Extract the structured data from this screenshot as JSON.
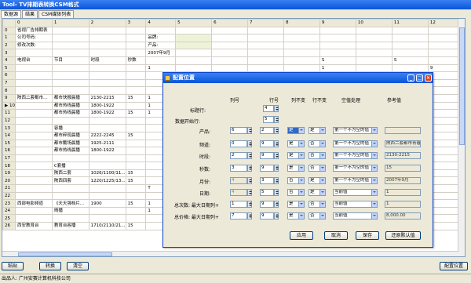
{
  "window": {
    "title": "Tool- TV排期表转换CSM格式"
  },
  "tabs": [
    "数据源",
    "结果",
    "CSM媒体列表"
  ],
  "sheet": {
    "col_headers": [
      "",
      "0",
      "1",
      "2",
      "3",
      "4",
      "5",
      "6",
      "7",
      "8",
      "9",
      "10",
      "11",
      "12"
    ],
    "rows": [
      [
        "0",
        "省视厂告排期表",
        "",
        "",
        "",
        "",
        "",
        "",
        "",
        "",
        "",
        "",
        "",
        ""
      ],
      [
        "1",
        "公司号码:",
        "",
        "",
        "",
        "品牌:",
        "",
        "",
        "",
        "",
        "",
        "",
        "",
        ""
      ],
      [
        "2",
        "修改次数:",
        "",
        "",
        "",
        "产品:",
        "",
        "",
        "",
        "",
        "",
        "",
        "",
        ""
      ],
      [
        "3",
        "",
        "",
        "",
        "",
        "2007年9月",
        "",
        "",
        "",
        "",
        "",
        "",
        "",
        ""
      ],
      [
        "4",
        "电视台",
        "节目",
        "时段",
        "秒数",
        "",
        "",
        "",
        "",
        "",
        "S",
        "",
        "S",
        ""
      ],
      [
        "5",
        "",
        "",
        "",
        "",
        "1",
        "",
        "",
        "",
        "",
        "1",
        "",
        "",
        "9"
      ],
      [
        "6",
        "",
        "",
        "",
        "",
        "",
        "",
        "",
        "",
        "",
        "",
        "",
        "",
        ""
      ],
      [
        "7",
        "",
        "",
        "",
        "",
        "",
        "",
        "",
        "",
        "",
        "",
        "",
        "",
        ""
      ],
      [
        "8",
        "",
        "",
        "",
        "",
        "",
        "",
        "",
        "",
        "",
        "",
        "",
        "",
        ""
      ],
      [
        "9",
        "陕西二套都市...",
        "都市快报晨播",
        "2130-2215",
        "15",
        "1",
        "",
        "",
        "",
        "",
        "",
        "",
        "",
        "1"
      ],
      [
        "10",
        "",
        "都市热线晨播",
        "1800-1922",
        "",
        "1",
        "",
        "",
        "",
        "",
        "",
        "",
        "",
        ""
      ],
      [
        "11",
        "",
        "都市热线晨播",
        "1800-1922",
        "15",
        "1",
        "",
        "",
        "",
        "",
        "",
        "",
        "",
        "1"
      ],
      [
        "12",
        "",
        "",
        "",
        "",
        "",
        "",
        "",
        "",
        "",
        "",
        "",
        "",
        ""
      ],
      [
        "13",
        "",
        "容播",
        "",
        "",
        "",
        "",
        "",
        "",
        "",
        "",
        "",
        "",
        ""
      ],
      [
        "14",
        "",
        "都市碎现晨播",
        "2222-2245",
        "15",
        "",
        "",
        "",
        "",
        "",
        "",
        "",
        "",
        ""
      ],
      [
        "15",
        "",
        "都市戴场晨播",
        "1925-2111",
        "",
        "",
        "",
        "",
        "",
        "",
        "",
        "",
        "",
        ""
      ],
      [
        "16",
        "",
        "都市热线晨播",
        "1800-1922",
        "",
        "",
        "",
        "",
        "",
        "",
        "",
        "",
        "",
        ""
      ],
      [
        "17",
        "",
        "",
        "",
        "",
        "",
        "",
        "",
        "",
        "",
        "",
        "",
        "",
        ""
      ],
      [
        "18",
        "",
        "C套播",
        "",
        "",
        "",
        "",
        "",
        "",
        "",
        "",
        "",
        "",
        ""
      ],
      [
        "19",
        "",
        "陕西二套",
        "1026/1100/11...",
        "15",
        "",
        "",
        "",
        "",
        "",
        "",
        "",
        "",
        "1"
      ],
      [
        "20",
        "",
        "陕西四套",
        "1220/1225/13...",
        "15",
        "",
        "",
        "",
        "",
        "",
        "",
        "",
        "",
        "5"
      ],
      [
        "21",
        "",
        "",
        "",
        "",
        "T",
        "",
        "",
        "",
        "",
        "",
        "",
        "",
        "T"
      ],
      [
        "22",
        "",
        "",
        "",
        "",
        "",
        "",
        "",
        "",
        "",
        "",
        "",
        "",
        ""
      ],
      [
        "23",
        "西部电影频道",
        "《天天强档片...",
        "1900",
        "15",
        "1",
        "",
        "",
        "",
        "",
        "",
        "",
        "",
        ""
      ],
      [
        "24",
        "",
        "晴播",
        "",
        "",
        "1",
        "",
        "",
        "",
        "",
        "",
        "",
        "",
        "1"
      ],
      [
        "25",
        "",
        "",
        "",
        "",
        "",
        "",
        "",
        "",
        "",
        "",
        "",
        "",
        ""
      ],
      [
        "26",
        "西安教育台",
        "教育台容播",
        "1710/2110/21...",
        "15",
        "",
        "",
        "",
        "",
        "",
        "",
        "",
        "",
        ""
      ]
    ],
    "current_row": "10"
  },
  "buttons": {
    "paste": "粘贴",
    "convert": "转换",
    "clear": "清空",
    "config": "配置位置"
  },
  "status": "出品人: 广州安赛计算机科技公司",
  "dialog": {
    "title": "配置位置",
    "col_headers": {
      "col": "列号",
      "row": "行号",
      "col_fixed": "列不变",
      "row_fixed": "行不变",
      "null": "空值处理",
      "ref": "参考值"
    },
    "title_row_label": "标题行:",
    "title_row_value": "4",
    "data_start_label": "数据开始行:",
    "data_start_value": "5",
    "rows": [
      {
        "label": "产品:",
        "col": "6",
        "row": "2",
        "col_fixed": "是",
        "row_fixed": "是",
        "null": "第一个不为空的值",
        "ref": "",
        "disabled": false
      },
      {
        "label": "频道:",
        "col": "0",
        "row": "9",
        "col_fixed": "是",
        "row_fixed": "否",
        "null": "第一个不为空的值",
        "ref": "陕西二套都市青春",
        "disabled": false
      },
      {
        "label": "时段:",
        "col": "2",
        "row": "9",
        "col_fixed": "是",
        "row_fixed": "否",
        "null": "第一个不为空的值",
        "ref": "2130-2215",
        "disabled": false
      },
      {
        "label": "秒数:",
        "col": "3",
        "row": "9",
        "col_fixed": "是",
        "row_fixed": "否",
        "null": "第一个不为空的值",
        "ref": "15",
        "disabled": false
      },
      {
        "label": "月份:",
        "col": "4",
        "row": "3",
        "col_fixed": "否",
        "row_fixed": "是",
        "null": "第一个不为空的值",
        "ref": "2007年9月",
        "disabled": true
      },
      {
        "label": "日期:",
        "col": "4",
        "row": "5",
        "col_fixed": "否",
        "row_fixed": "是",
        "null": "当前值",
        "ref": "1",
        "disabled": true
      },
      {
        "label": "总次数: 最大日期列+",
        "col": "1",
        "row": "9",
        "col_fixed": "是",
        "row_fixed": "否",
        "null": "当前值",
        "ref": "1",
        "disabled": false
      },
      {
        "label": "总价格: 最大日期列+",
        "col": "7",
        "row": "9",
        "col_fixed": "是",
        "row_fixed": "否",
        "null": "当前值",
        "ref": "8,000.00",
        "disabled": false
      }
    ],
    "buttons": {
      "apply": "应用",
      "cancel": "取消",
      "save": "保存",
      "restore": "还原默认值"
    }
  }
}
